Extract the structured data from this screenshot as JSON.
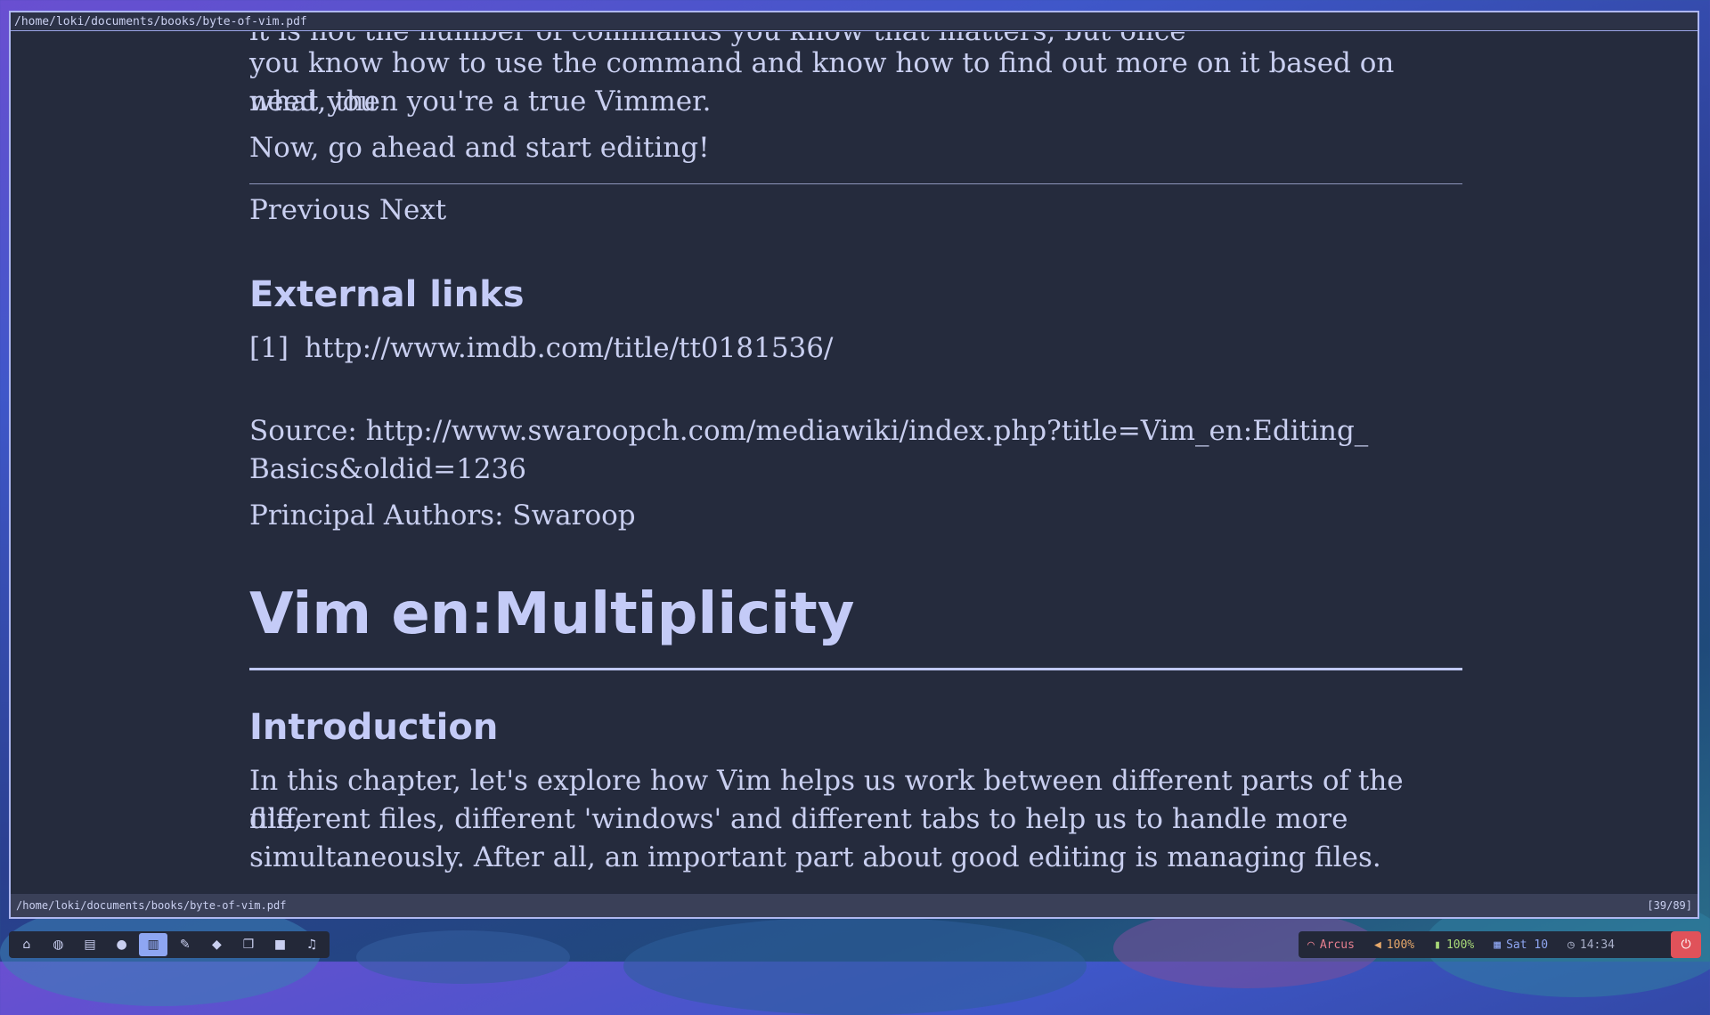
{
  "window": {
    "title": "/home/loki/documents/books/byte-of-vim.pdf"
  },
  "document": {
    "clipped_line": "it is not the number of commands you know that matters, but once",
    "intro_lines": [
      "you know how to use the command and know how to find out more on it based on what you",
      "need, then you're a true Vimmer."
    ],
    "go_ahead": "Now, go ahead and start editing!",
    "nav": "Previous Next",
    "external_heading": "External links",
    "link_ref": "[1]",
    "link_url": "http://www.imdb.com/title/tt0181536/",
    "source_lines": [
      "Source: http://www.swaroopch.com/mediawiki/index.php?title=Vim_en:Editing_",
      "Basics&oldid=1236"
    ],
    "authors": "Principal Authors: Swaroop",
    "chapter_title": "Vim en:Multiplicity",
    "intro_heading": "Introduction",
    "chapter_para": [
      "In this chapter, let's explore how Vim helps us work between different parts of the file,",
      "different files, different 'windows' and different tabs to help us to handle more",
      "simultaneously. After all, an important part about good editing is managing files."
    ]
  },
  "statusbar": {
    "path": "/home/loki/documents/books/byte-of-vim.pdf",
    "page": "[39/89]"
  },
  "taskbar": {
    "buttons": [
      {
        "icon": "home-icon",
        "glyph": "⌂"
      },
      {
        "icon": "globe-icon",
        "glyph": "◍"
      },
      {
        "icon": "file-icon",
        "glyph": "▤"
      },
      {
        "icon": "chat-icon",
        "glyph": "●"
      },
      {
        "icon": "book-icon",
        "glyph": "▥"
      },
      {
        "icon": "edit-icon",
        "glyph": "✎"
      },
      {
        "icon": "code-icon",
        "glyph": "◆"
      },
      {
        "icon": "windows-icon",
        "glyph": "❐"
      },
      {
        "icon": "video-icon",
        "glyph": "■"
      },
      {
        "icon": "music-icon",
        "glyph": "♫"
      }
    ],
    "active_index": 4
  },
  "tray": {
    "wifi": "Arcus",
    "volume": "100%",
    "battery": "100%",
    "date": "Sat 10",
    "time": "14:34"
  },
  "colors": {
    "wifi": "#e67f8f",
    "volume": "#e6a86a",
    "battery": "#a8d878",
    "date": "#8ea6f2",
    "time": "#a9b0c9"
  }
}
